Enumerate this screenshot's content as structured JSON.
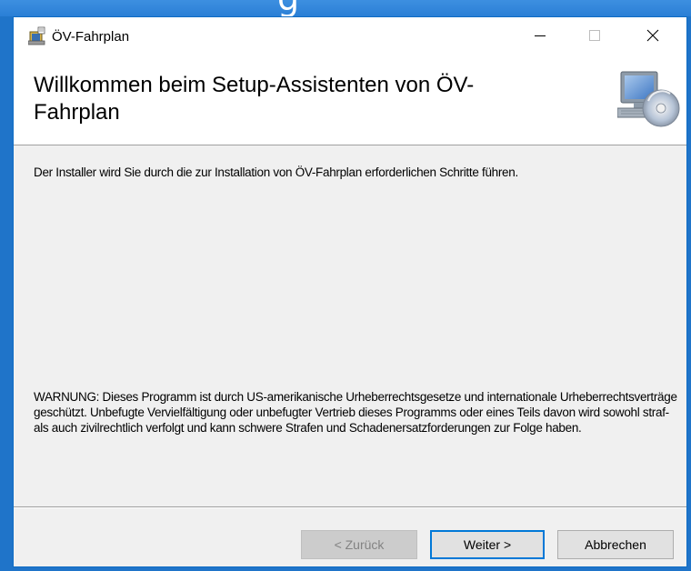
{
  "window": {
    "title": "ÖV-Fahrplan"
  },
  "titlebar_controls": {
    "minimize_icon": "minimize-icon",
    "maximize_icon": "maximize-icon",
    "close_icon": "close-icon"
  },
  "header": {
    "title": "Willkommen beim Setup-Assistenten von ÖV-Fahrplan",
    "graphic_icon": "computer-cd-icon"
  },
  "content": {
    "intro": "Der Installer wird Sie durch die zur Installation von ÖV-Fahrplan erforderlichen Schritte führen.",
    "warning": "WARNUNG: Dieses Programm ist durch US-amerikanische Urheberrechtsgesetze und internationale Urheberrechtsverträge geschützt. Unbefugte Vervielfältigung oder unbefugter Vertrieb dieses Programms oder eines Teils davon wird sowohl straf- als auch zivilrechtlich verfolgt und kann schwere Strafen und Schadenersatzforderungen zur Folge haben."
  },
  "buttons": {
    "back": "< Zurück",
    "next": "Weiter >",
    "cancel": "Abbrechen"
  },
  "colors": {
    "accent": "#0078d7",
    "window_border": "#0f6cc4",
    "dialog_background": "#f0f0f0"
  }
}
